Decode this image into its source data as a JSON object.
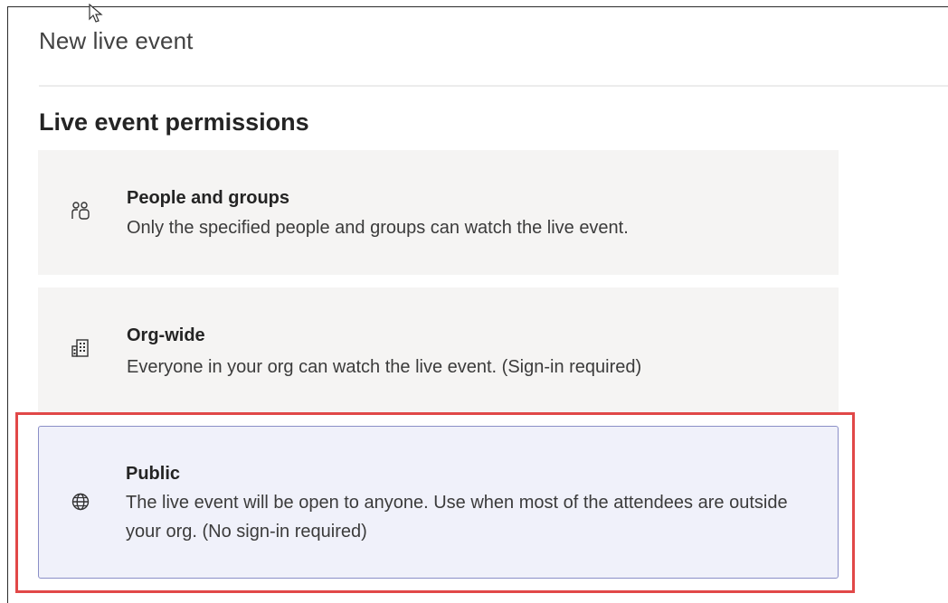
{
  "dialog": {
    "title": "New live event"
  },
  "section": {
    "title": "Live event permissions"
  },
  "options": [
    {
      "id": "people",
      "icon": "people-icon",
      "title": "People and groups",
      "description": "Only the specified people and groups can watch the live event.",
      "selected": false
    },
    {
      "id": "org",
      "icon": "building-icon",
      "title": "Org-wide",
      "description": "Everyone in your org can watch the live event. (Sign-in required)",
      "selected": false
    },
    {
      "id": "public",
      "icon": "globe-icon",
      "title": "Public",
      "description": "The live event will be open to anyone. Use when most of the attendees are outside your org. (No sign-in required)",
      "selected": true
    }
  ],
  "colors": {
    "card_background": "#f5f4f3",
    "selected_background": "#f0f1fa",
    "selected_border": "#8b8fc7",
    "highlight_annotation": "#e14848"
  }
}
